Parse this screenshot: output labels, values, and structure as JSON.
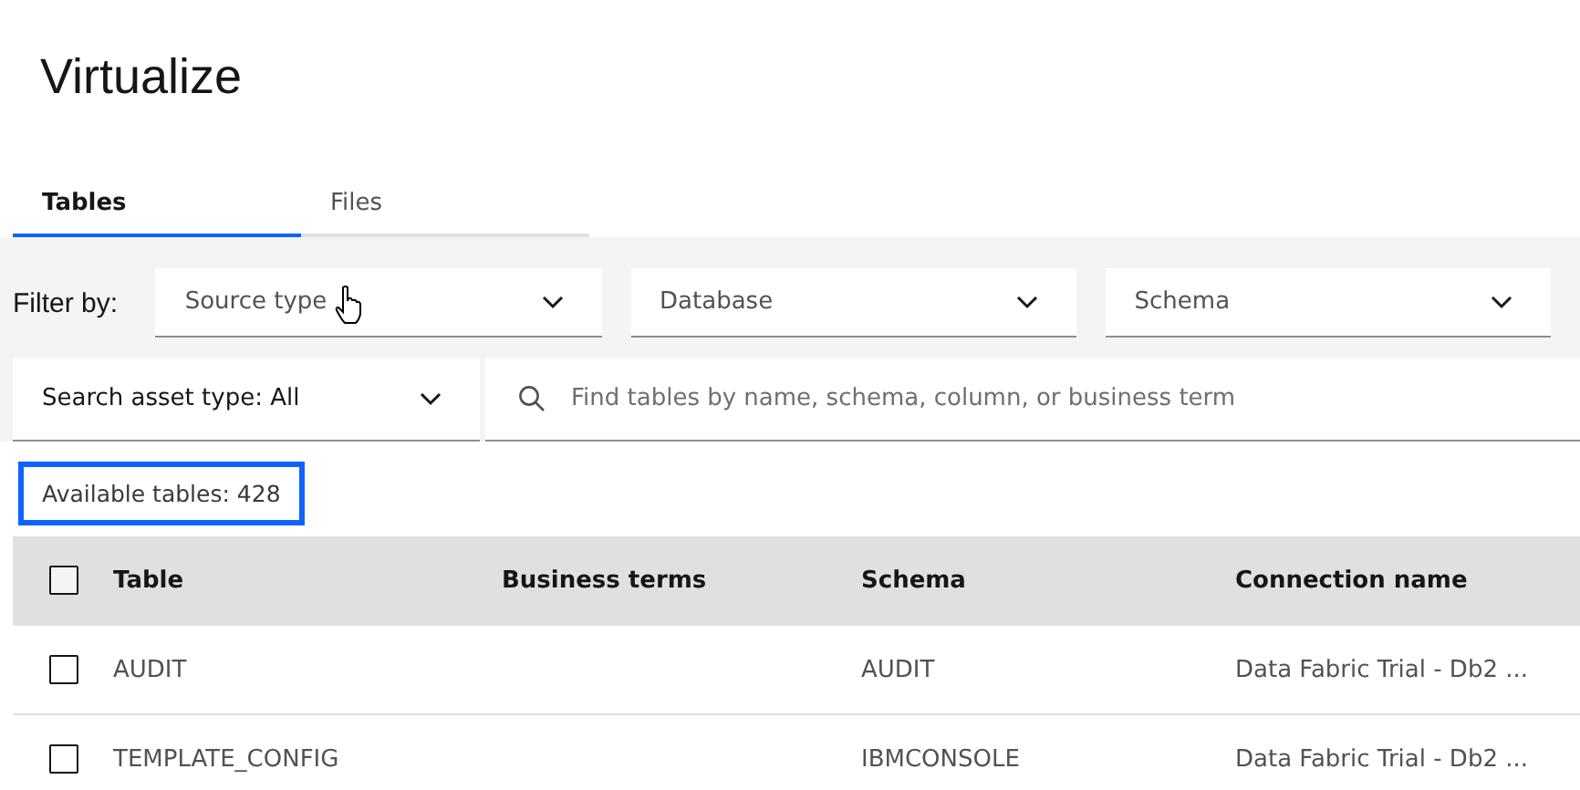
{
  "page_title": "Virtualize",
  "tabs": [
    {
      "label": "Tables",
      "selected": true
    },
    {
      "label": "Files",
      "selected": false
    }
  ],
  "filters": {
    "label": "Filter by:",
    "dropdowns": [
      {
        "placeholder": "Source type"
      },
      {
        "placeholder": "Database"
      },
      {
        "placeholder": "Schema"
      }
    ]
  },
  "search": {
    "asset_type": "Search asset type: All",
    "placeholder": "Find tables by name, schema, column, or business term"
  },
  "count": {
    "text": "Available tables: 428",
    "highlighted": true
  },
  "table": {
    "select_all_checked": false,
    "columns": [
      "Table",
      "Business terms",
      "Schema",
      "Connection name"
    ],
    "rows": [
      {
        "checked": false,
        "cells": [
          "AUDIT",
          "",
          "AUDIT",
          "Data Fabric Trial - Db2 ..."
        ]
      },
      {
        "checked": false,
        "cells": [
          "TEMPLATE_CONFIG",
          "",
          "IBMCONSOLE",
          "Data Fabric Trial - Db2 ..."
        ]
      }
    ]
  }
}
